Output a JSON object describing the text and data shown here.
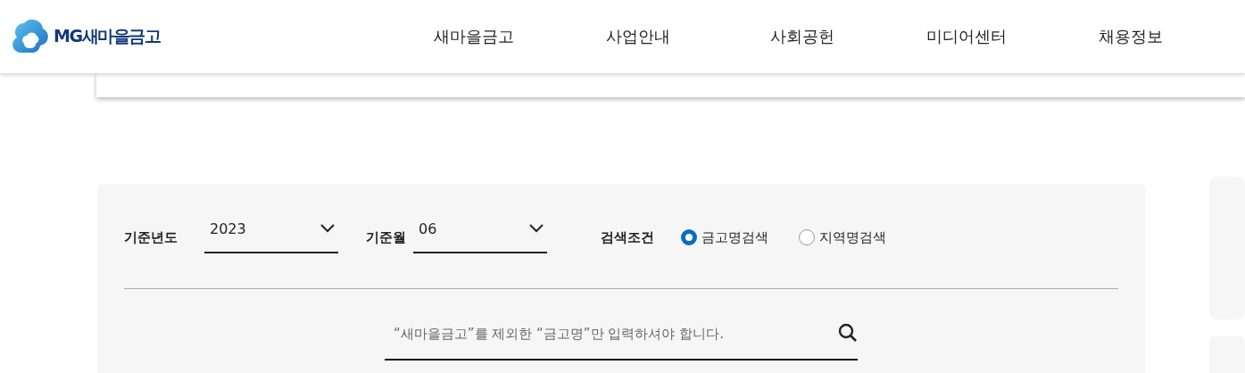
{
  "header": {
    "logo": "MG새마을금고",
    "nav": [
      "새마을금고",
      "사업안내",
      "사회공헌",
      "미디어센터",
      "채용정보"
    ]
  },
  "filters": {
    "year": {
      "label": "기준년도",
      "value": "2023"
    },
    "month": {
      "label": "기준월",
      "value": "06"
    },
    "condition": {
      "label": "검색조건",
      "options": [
        {
          "label": "금고명검색",
          "selected": true
        },
        {
          "label": "지역명검색",
          "selected": false
        }
      ]
    }
  },
  "search": {
    "placeholder": "“새마을금고”를 제외한 “금고명”만 입력하셔야 합니다."
  }
}
